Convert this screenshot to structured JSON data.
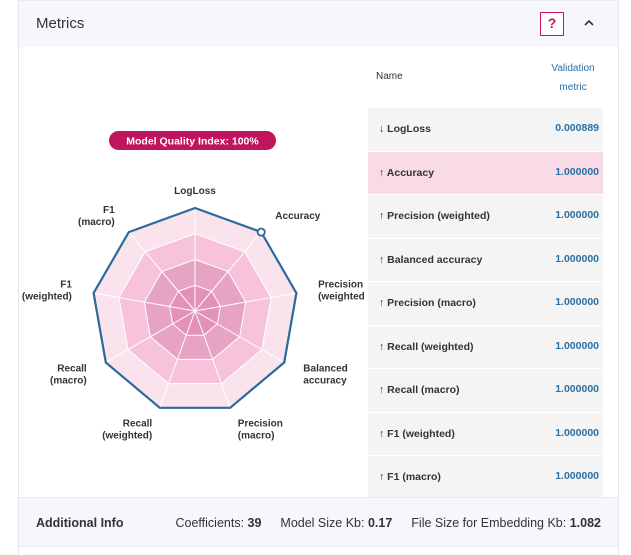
{
  "header": {
    "title": "Metrics",
    "help_label": "?"
  },
  "badge": {
    "text": "Model Quality Index: 100%"
  },
  "radar": {
    "axes": [
      [
        "LogLoss"
      ],
      [
        "Accuracy"
      ],
      [
        "Precision",
        "(weighted)"
      ],
      [
        "Balanced",
        "accuracy"
      ],
      [
        "Precision",
        "(macro)"
      ],
      [
        "Recall",
        "(weighted)"
      ],
      [
        "Recall",
        "(macro)"
      ],
      [
        "F1",
        "(weighted)"
      ],
      [
        "F1",
        "(macro)"
      ]
    ],
    "values": [
      1,
      1,
      1,
      1,
      1,
      1,
      1,
      1,
      1
    ],
    "highlight_axis": 1,
    "colors": {
      "fill_dark": "#e7a3c4",
      "fill_light": "#fbe3ee",
      "grid": "#ffffff",
      "line": "#2a6a9c",
      "badge": "#c0145c"
    }
  },
  "table": {
    "col_name": "Name",
    "col_value": [
      "Validation",
      "metric"
    ],
    "rows": [
      {
        "arrow": "↓",
        "name": "LogLoss",
        "value": "0.000889",
        "highlight": false
      },
      {
        "arrow": "↑",
        "name": "Accuracy",
        "value": "1.000000",
        "highlight": true
      },
      {
        "arrow": "↑",
        "name": "Precision (weighted)",
        "value": "1.000000",
        "highlight": false
      },
      {
        "arrow": "↑",
        "name": "Balanced accuracy",
        "value": "1.000000",
        "highlight": false
      },
      {
        "arrow": "↑",
        "name": "Precision (macro)",
        "value": "1.000000",
        "highlight": false
      },
      {
        "arrow": "↑",
        "name": "Recall (weighted)",
        "value": "1.000000",
        "highlight": false
      },
      {
        "arrow": "↑",
        "name": "Recall (macro)",
        "value": "1.000000",
        "highlight": false
      },
      {
        "arrow": "↑",
        "name": "F1 (weighted)",
        "value": "1.000000",
        "highlight": false
      },
      {
        "arrow": "↑",
        "name": "F1 (macro)",
        "value": "1.000000",
        "highlight": false
      }
    ]
  },
  "footer": {
    "title": "Additional Info",
    "coefficients_label": "Coefficients:",
    "coefficients_value": "39",
    "model_size_label": "Model Size Kb:",
    "model_size_value": "0.17",
    "embed_label": "File Size for Embedding Kb:",
    "embed_value": "1.082"
  }
}
